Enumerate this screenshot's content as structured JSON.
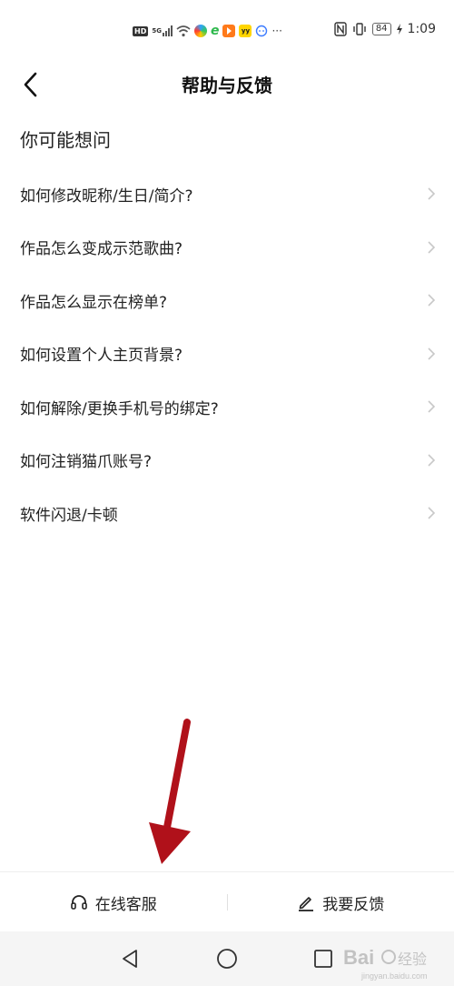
{
  "status_bar": {
    "hd_label": "HD",
    "network_label": "5G",
    "battery": "84",
    "time": "1:09",
    "dots": "···"
  },
  "header": {
    "title": "帮助与反馈"
  },
  "faq": {
    "heading": "你可能想问",
    "items": [
      {
        "label": "如何修改昵称/生日/简介?"
      },
      {
        "label": "作品怎么变成示范歌曲?"
      },
      {
        "label": "作品怎么显示在榜单?"
      },
      {
        "label": "如何设置个人主页背景?"
      },
      {
        "label": "如何解除/更换手机号的绑定?"
      },
      {
        "label": "如何注销猫爪账号?"
      },
      {
        "label": "软件闪退/卡顿"
      }
    ]
  },
  "bottom_bar": {
    "online_service_label": "在线客服",
    "feedback_label": "我要反馈"
  },
  "colors": {
    "annotation_arrow": "#b0111a",
    "chevron": "#c8c8c8",
    "nav_background": "#f5f5f5"
  },
  "icons": {
    "back": "chevron-left-icon",
    "headset": "headset-icon",
    "edit": "pencil-icon",
    "nav_back": "triangle-back-icon",
    "nav_home": "circle-home-icon",
    "nav_recent": "square-recent-icon"
  }
}
